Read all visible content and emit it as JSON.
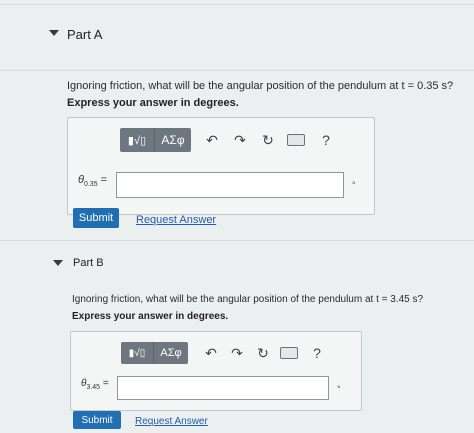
{
  "parts": [
    {
      "title": "Part A",
      "question": "Ignoring friction, what will be the angular position of the pendulum at t = 0.35 s?",
      "instruction": "Express your answer in degrees.",
      "variable_symbol": "θ",
      "variable_subscript": "0.35",
      "variable_equals": "=",
      "answer_value": "",
      "unit": "°",
      "submit_label": "Submit",
      "request_label": "Request Answer"
    },
    {
      "title": "Part B",
      "question": "Ignoring friction, what will be the angular position of the pendulum at t = 3.45 s?",
      "instruction": "Express your answer in degrees.",
      "variable_symbol": "θ",
      "variable_subscript": "3.45",
      "variable_equals": "=",
      "answer_value": "",
      "unit": "°",
      "submit_label": "Submit",
      "request_label": "Request Answer"
    }
  ],
  "toolbar": {
    "templates_glyph": "▮√▯",
    "greek_label": "ΑΣφ",
    "undo_glyph": "↶",
    "redo_glyph": "↷",
    "reset_glyph": "↻",
    "help_glyph": "?"
  },
  "colors": {
    "submit": "#1f6fb2",
    "link": "#1f5ea8",
    "toolbar_group": "#6e7780"
  }
}
